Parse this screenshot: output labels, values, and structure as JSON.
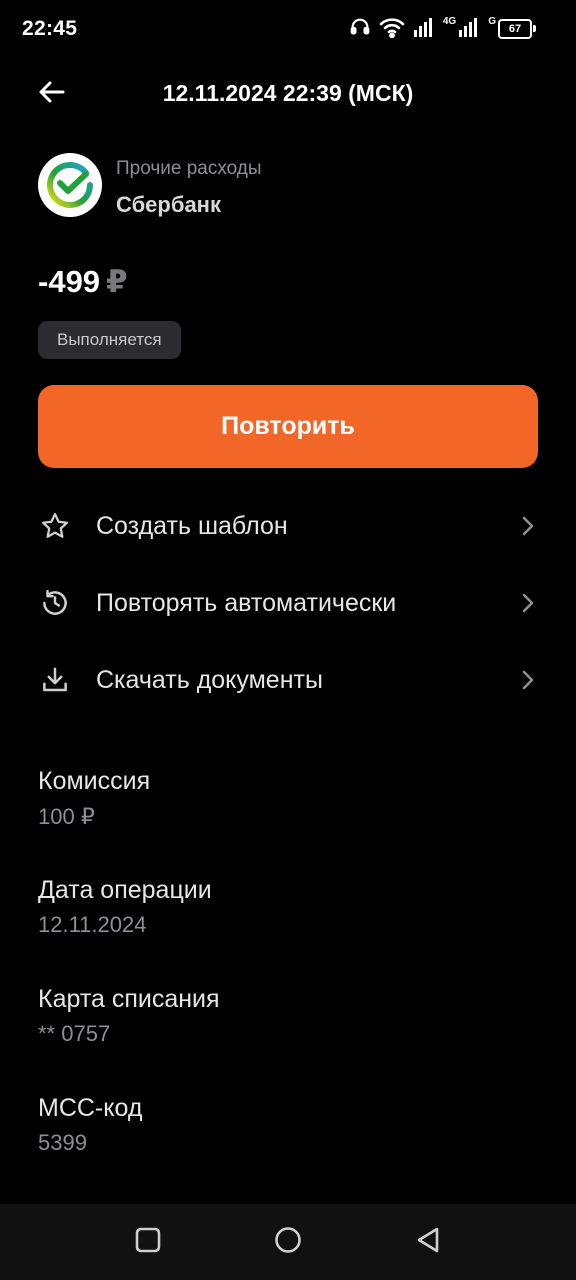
{
  "status_bar": {
    "time": "22:45",
    "network1": "4G",
    "network2": "G",
    "battery": "67"
  },
  "header": {
    "title": "12.11.2024 22:39 (МСК)"
  },
  "operation": {
    "category": "Прочие расходы",
    "merchant": "Сбербанк",
    "amount": "-499",
    "currency": "₽",
    "status": "Выполняется"
  },
  "primary_action": {
    "label": "Повторить",
    "color": "#f26628"
  },
  "actions": [
    {
      "label": "Создать шаблон",
      "icon": "star-icon"
    },
    {
      "label": "Повторять автоматически",
      "icon": "history-icon"
    },
    {
      "label": "Скачать документы",
      "icon": "download-icon"
    }
  ],
  "details": [
    {
      "label": "Комиссия",
      "value": "100 ₽"
    },
    {
      "label": "Дата операции",
      "value": "12.11.2024"
    },
    {
      "label": "Карта списания",
      "value": "** 0757"
    },
    {
      "label": "MCC-код",
      "value": "5399"
    }
  ],
  "navigation_bar": {
    "buttons": [
      "recents-icon",
      "home-icon",
      "back-nav-icon"
    ]
  }
}
